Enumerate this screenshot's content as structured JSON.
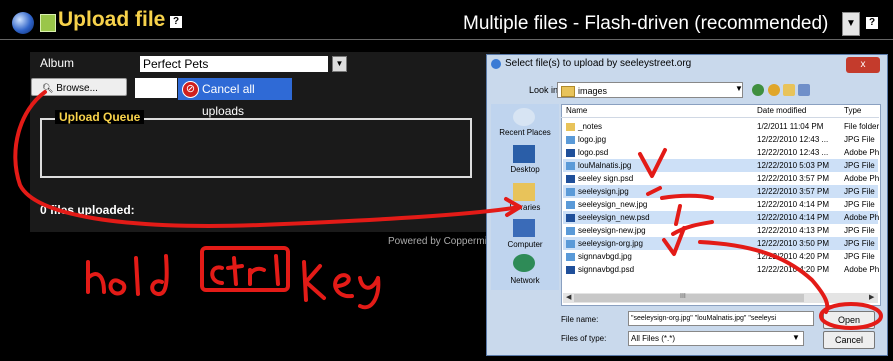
{
  "header": {
    "title": "Upload file",
    "help": "?",
    "mode_select": "Multiple files - Flash-driven (recommended)"
  },
  "form": {
    "album_label": "Album",
    "album_value": "Perfect Pets",
    "browse_label": "Browse...",
    "cancel_label": "Cancel all uploads",
    "queue_label": "Upload Queue",
    "files_uploaded": "0 files uploaded:",
    "powered_by": "Powered by Coppermine"
  },
  "dialog": {
    "title": "Select file(s) to upload by seeleystreet.org",
    "look_in_label": "Look in:",
    "look_in_value": "images",
    "places": [
      "Recent Places",
      "Desktop",
      "Libraries",
      "Computer",
      "Network"
    ],
    "columns": [
      "Name",
      "Date modified",
      "Type"
    ],
    "rows": [
      {
        "name": "_notes",
        "date": "1/2/2011 11:04 PM",
        "type": "File folder",
        "selected": false
      },
      {
        "name": "logo.jpg",
        "date": "12/22/2010 12:43 ...",
        "type": "JPG File",
        "selected": false
      },
      {
        "name": "logo.psd",
        "date": "12/22/2010 12:43 ...",
        "type": "Adobe Ph",
        "selected": false
      },
      {
        "name": "louMalnatis.jpg",
        "date": "12/22/2010 5:03 PM",
        "type": "JPG File",
        "selected": true
      },
      {
        "name": "seeley sign.psd",
        "date": "12/22/2010 3:57 PM",
        "type": "Adobe Ph",
        "selected": false
      },
      {
        "name": "seeleysign.jpg",
        "date": "12/22/2010 3:57 PM",
        "type": "JPG File",
        "selected": true
      },
      {
        "name": "seeleysign_new.jpg",
        "date": "12/22/2010 4:14 PM",
        "type": "JPG File",
        "selected": false
      },
      {
        "name": "seeleysign_new.psd",
        "date": "12/22/2010 4:14 PM",
        "type": "Adobe Ph",
        "selected": true
      },
      {
        "name": "seeleysign-new.jpg",
        "date": "12/22/2010 4:13 PM",
        "type": "JPG File",
        "selected": false
      },
      {
        "name": "seeleysign-org.jpg",
        "date": "12/22/2010 3:50 PM",
        "type": "JPG File",
        "selected": true
      },
      {
        "name": "signnavbgd.jpg",
        "date": "12/22/2010 4:20 PM",
        "type": "JPG File",
        "selected": false
      },
      {
        "name": "signnavbgd.psd",
        "date": "12/22/2010 4:20 PM",
        "type": "Adobe Ph",
        "selected": false
      }
    ],
    "scroll_grip": "III",
    "file_name_label": "File name:",
    "file_name_value": "\"seeleysign-org.jpg\" \"louMalnatis.jpg\" \"seeleysi",
    "file_type_label": "Files of type:",
    "file_type_value": "All Files (*.*)",
    "open_label": "Open",
    "cancel_label": "Cancel",
    "close_label": "x"
  },
  "annotation": {
    "handwritten_note": "hold ctrl key",
    "ink_color": "#e31b17"
  },
  "colors": {
    "title_gold": "#f7d24b",
    "cancel_blue": "#2f6ad6",
    "selection": "#cde0f7"
  }
}
